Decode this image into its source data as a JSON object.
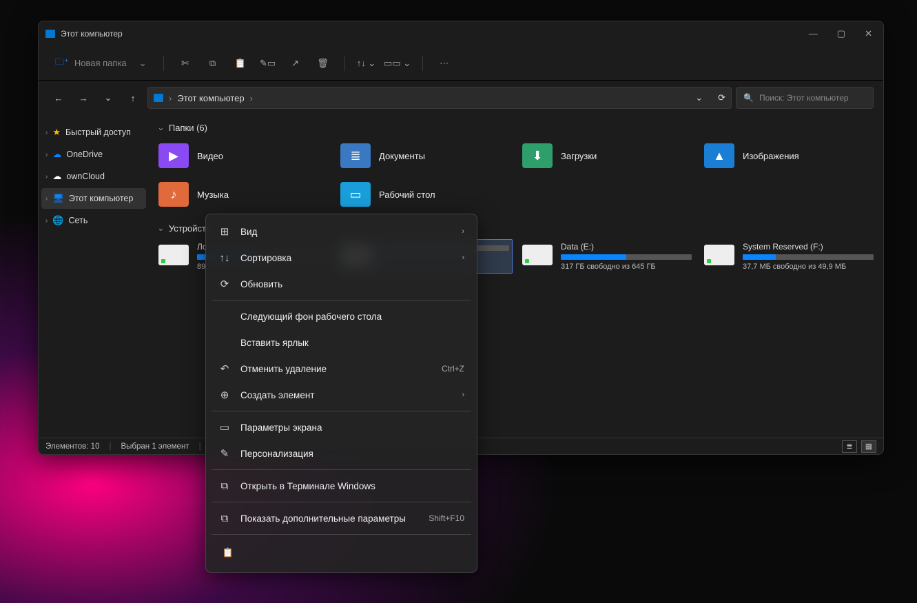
{
  "window": {
    "title": "Этот компьютер"
  },
  "toolbar": {
    "new_folder": "Новая папка"
  },
  "address": {
    "root": "Этот компьютер"
  },
  "search": {
    "placeholder": "Поиск: Этот компьютер"
  },
  "sidebar": {
    "items": [
      {
        "label": "Быстрый доступ",
        "icon": "star",
        "color": "#ffb900"
      },
      {
        "label": "OneDrive",
        "icon": "cloud",
        "color": "#0a84ff"
      },
      {
        "label": "ownCloud",
        "icon": "cloud",
        "color": "#ffffff"
      },
      {
        "label": "Этот компьютер",
        "icon": "pc",
        "color": "#0a84ff"
      },
      {
        "label": "Сеть",
        "icon": "globe",
        "color": "#0a84ff"
      }
    ],
    "selected_index": 3
  },
  "sections": {
    "folders_header": "Папки (6)",
    "folders": [
      {
        "label": "Видео",
        "color": "#8a4af3",
        "glyph": "▶"
      },
      {
        "label": "Документы",
        "color": "#3a78c2",
        "glyph": "≣"
      },
      {
        "label": "Загрузки",
        "color": "#2e9e6b",
        "glyph": "⬇"
      },
      {
        "label": "Изображения",
        "color": "#1a7fd4",
        "glyph": "▲"
      },
      {
        "label": "Музыка",
        "color": "#e06a3b",
        "glyph": "♪"
      },
      {
        "label": "Рабочий стол",
        "color": "#1a9ed9",
        "glyph": "▭"
      }
    ],
    "devices_header": "Устройств",
    "drives": [
      {
        "name": "Ло",
        "free": "89,",
        "fill_pct": 47
      },
      {
        "name": "",
        "free": "",
        "fill_pct": 0
      },
      {
        "name": "Data (E:)",
        "free": "317 ГБ свободно из 645 ГБ",
        "fill_pct": 50
      },
      {
        "name": "System Reserved (F:)",
        "free": "37,7 МБ свободно из 49,9 МБ",
        "fill_pct": 25
      }
    ],
    "selected_drive_index": 1
  },
  "status": {
    "count": "Элементов: 10",
    "selected": "Выбран 1 элемент"
  },
  "context_menu": {
    "items": [
      {
        "icon": "⊞",
        "label": "Вид",
        "arrow": true
      },
      {
        "icon": "↑↓",
        "label": "Сортировка",
        "arrow": true
      },
      {
        "icon": "⟳",
        "label": "Обновить"
      },
      {
        "sep": true
      },
      {
        "icon": "",
        "label": "Следующий фон рабочего стола"
      },
      {
        "icon": "",
        "label": "Вставить ярлык"
      },
      {
        "icon": "↶",
        "label": "Отменить удаление",
        "shortcut": "Ctrl+Z"
      },
      {
        "icon": "⊕",
        "label": "Создать элемент",
        "arrow": true
      },
      {
        "sep": true
      },
      {
        "icon": "▭",
        "label": "Параметры экрана"
      },
      {
        "icon": "✎",
        "label": "Персонализация"
      },
      {
        "sep": true
      },
      {
        "icon": "⧉",
        "label": "Открыть в Терминале Windows"
      },
      {
        "sep": true
      },
      {
        "icon": "⧉",
        "label": "Показать дополнительные параметры",
        "shortcut": "Shift+F10"
      }
    ]
  }
}
